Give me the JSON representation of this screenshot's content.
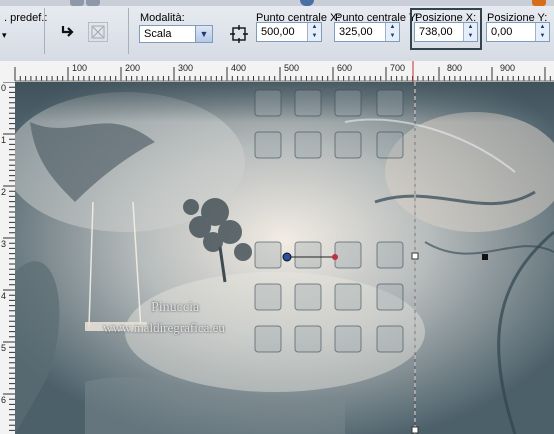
{
  "toolbar": {
    "preset_label": ". predef.:",
    "mode_label": "Modalità:",
    "mode_value": "Scala",
    "center_x_label": "Punto centrale X:",
    "center_x_value": "500,00",
    "center_y_label": "Punto centrale Y:",
    "center_y_value": "325,00",
    "pos_x_label": "Posizione X:",
    "pos_x_value": "738,00",
    "pos_y_label": "Posizione Y:",
    "pos_y_value": "0,00"
  },
  "ruler_h": [
    "100",
    "200",
    "300",
    "400",
    "500",
    "600",
    "700",
    "800",
    "900"
  ],
  "ruler_v": [
    "0",
    "1",
    "2",
    "3",
    "4",
    "5",
    "6"
  ],
  "canvas": {
    "watermark_line1": "Pinuccia",
    "watermark_line2": "www.maldiregrafica.eu"
  },
  "colors": {
    "accent": "#34444e",
    "canvas": "#6a7d86"
  }
}
